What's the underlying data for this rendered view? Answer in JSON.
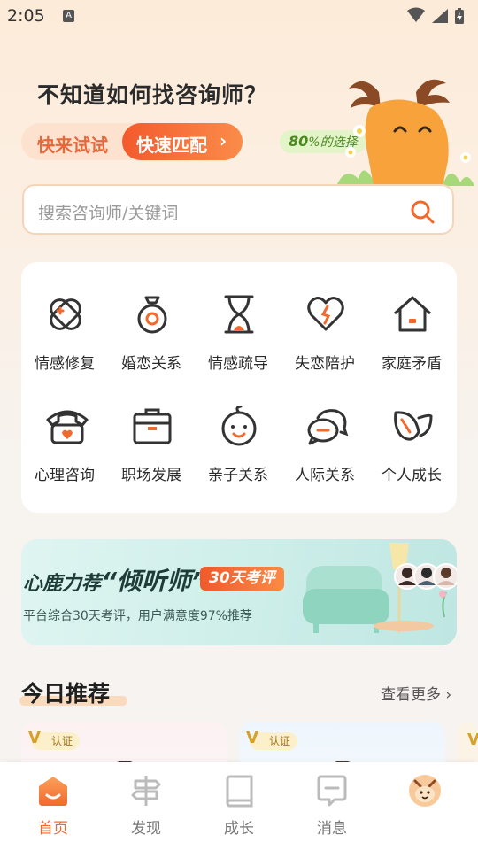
{
  "status_bar": {
    "time": "2:05",
    "notification_icon": "A"
  },
  "hero": {
    "title": "不知道如何找咨询师？",
    "try_label": "快来试试",
    "match_label": "快速匹配",
    "match_chevron": "›",
    "choice_badge_number": "80",
    "choice_badge_text": "%的选择"
  },
  "search": {
    "placeholder": "搜索咨询师/关键词"
  },
  "categories": [
    {
      "label": "情感修复",
      "icon": "bandage-icon"
    },
    {
      "label": "婚恋关系",
      "icon": "ring-icon"
    },
    {
      "label": "情感疏导",
      "icon": "hourglass-icon"
    },
    {
      "label": "失恋陪护",
      "icon": "broken-heart-icon"
    },
    {
      "label": "家庭矛盾",
      "icon": "home-icon"
    },
    {
      "label": "心理咨询",
      "icon": "telephone-icon"
    },
    {
      "label": "职场发展",
      "icon": "briefcase-icon"
    },
    {
      "label": "亲子关系",
      "icon": "baby-icon"
    },
    {
      "label": "人际关系",
      "icon": "chat-bubbles-icon"
    },
    {
      "label": "个人成长",
      "icon": "leaf-icon"
    }
  ],
  "banner": {
    "title_prefix": "心鹿力荐",
    "title_highlight": "“倾听师”",
    "tag": "30天考评",
    "subtitle": "平台综合30天考评，用户满意度97%推荐"
  },
  "recommend": {
    "title": "今日推荐",
    "see_more": "查看更多",
    "see_more_chevron": "›",
    "badge": "认证"
  },
  "tabbar": [
    {
      "label": "首页",
      "icon": "home-tab-icon",
      "active": true
    },
    {
      "label": "发现",
      "icon": "signpost-icon",
      "active": false
    },
    {
      "label": "成长",
      "icon": "book-icon",
      "active": false
    },
    {
      "label": "消息",
      "icon": "message-icon",
      "active": false
    },
    {
      "label": "",
      "icon": "avatar-icon",
      "active": false
    }
  ],
  "colors": {
    "accent": "#f2692c",
    "brand_orange": "#fb8c4a"
  }
}
